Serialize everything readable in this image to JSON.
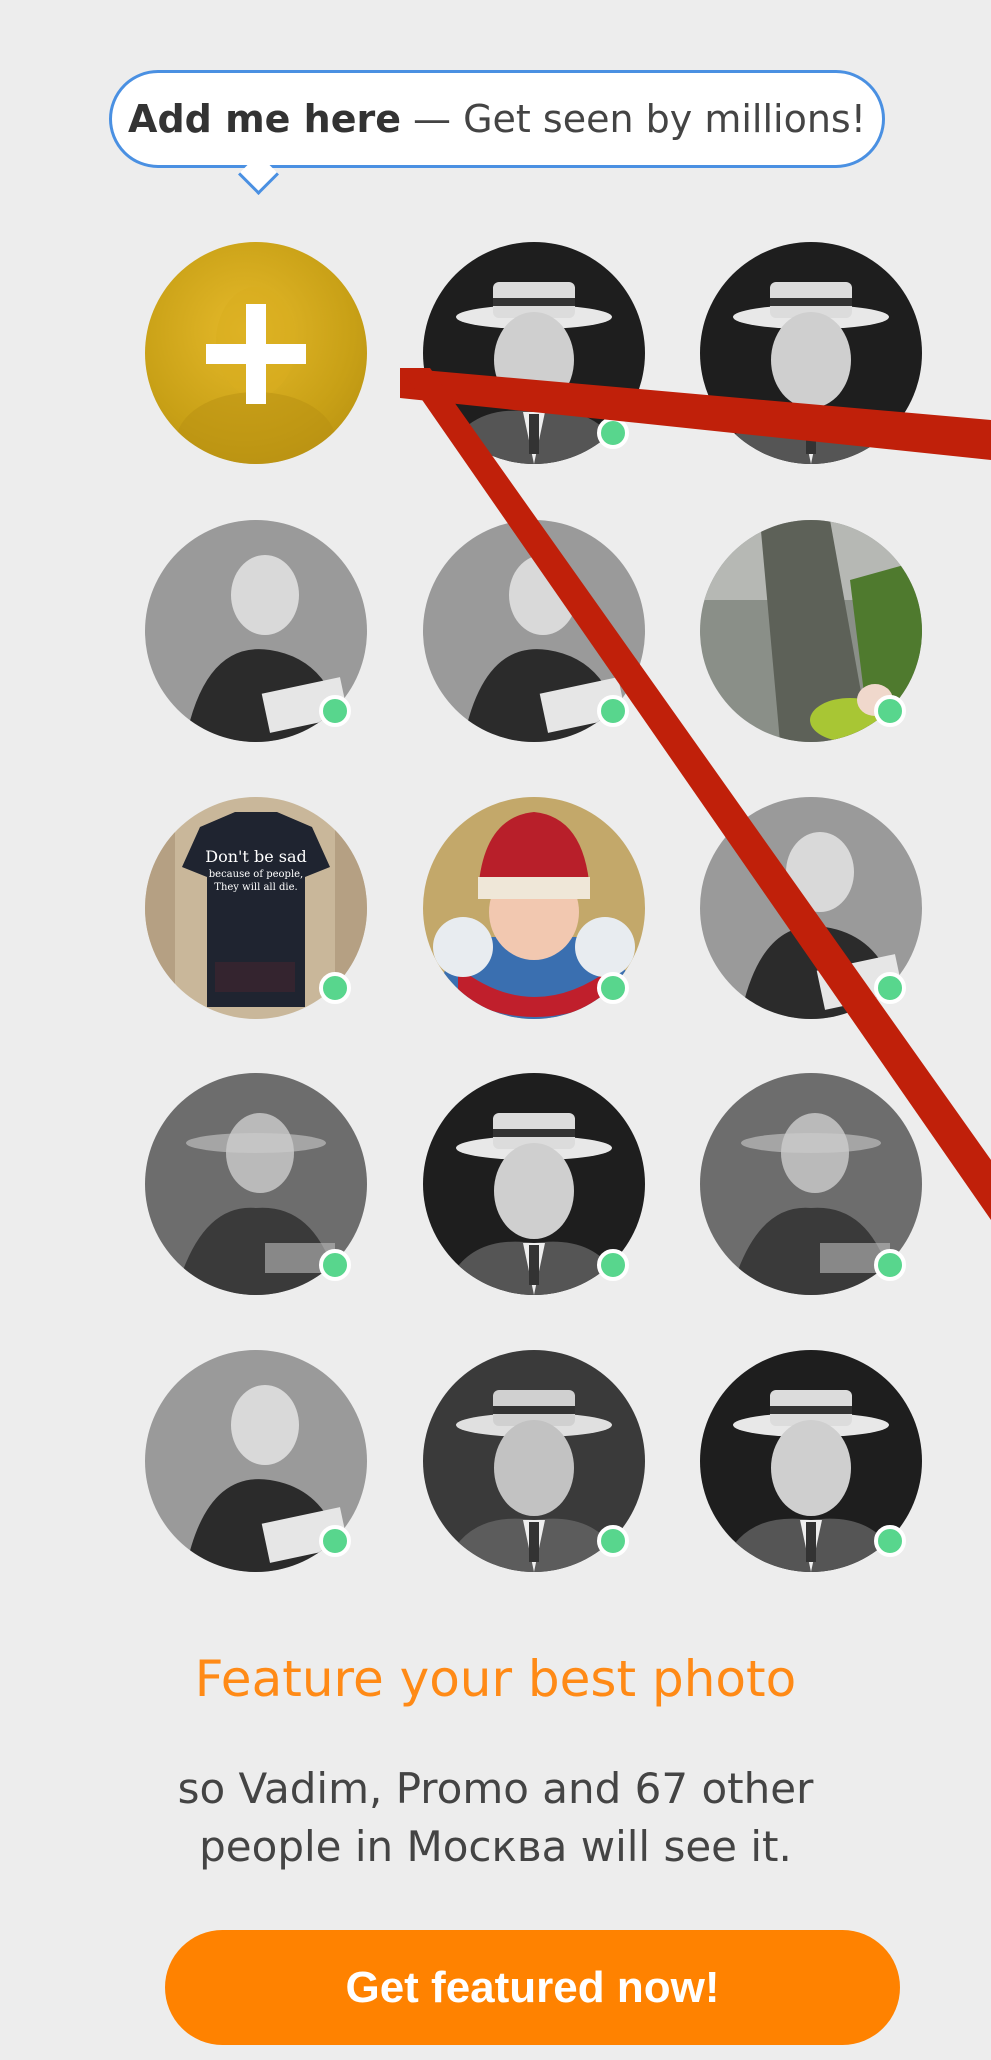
{
  "header_bubble": {
    "bold": "Add me here",
    "rest": "— Get seen by millions!"
  },
  "grid": {
    "add_symbol": "+",
    "avatars": [
      {
        "kind": "add",
        "icon": "plus-icon",
        "online": false
      },
      {
        "kind": "hat-man",
        "online": true
      },
      {
        "kind": "hat-man",
        "online": true
      },
      {
        "kind": "old-man",
        "online": true
      },
      {
        "kind": "old-man",
        "online": true
      },
      {
        "kind": "nature",
        "online": true
      },
      {
        "kind": "tshirt",
        "online": true,
        "tshirt_text": [
          "Don't be sad",
          "because of people,",
          "They will all die."
        ]
      },
      {
        "kind": "girl",
        "online": true
      },
      {
        "kind": "old-man",
        "online": true
      },
      {
        "kind": "mixed",
        "online": true
      },
      {
        "kind": "hat-man",
        "online": true
      },
      {
        "kind": "mixed",
        "online": true
      },
      {
        "kind": "old-man",
        "online": true
      },
      {
        "kind": "hat-man",
        "online": true
      },
      {
        "kind": "hat-man",
        "online": true
      }
    ]
  },
  "feature": {
    "title": "Feature your best photo",
    "text_line1": "so Vadim, Promo and 67 other",
    "text_line2": "people in Москва will see it."
  },
  "cta": {
    "label": "Get featured now!"
  },
  "colors": {
    "background": "#ededed",
    "accent": "#ff8200",
    "title_orange": "#ff8a16",
    "bubble_border": "#4a90e2",
    "online_dot": "#58d68d",
    "annotation_red": "#c0200a"
  }
}
